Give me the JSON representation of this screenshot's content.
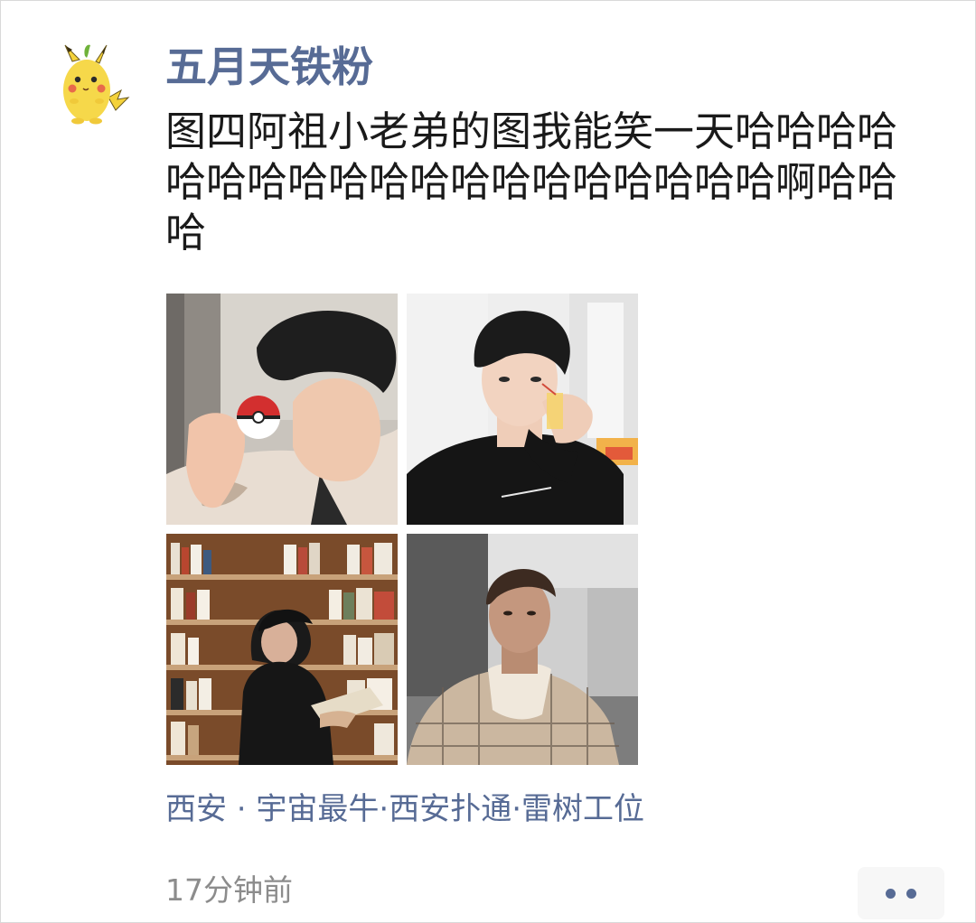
{
  "post": {
    "username": "五月天铁粉",
    "text": "图四阿祖小老弟的图我能笑一天哈哈哈哈哈哈哈哈哈哈哈哈哈哈哈哈哈哈哈啊哈哈哈",
    "location": "西安 · 宇宙最牛·西安扑通·雷树工位",
    "time": "17分钟前",
    "avatar_icon": "pikachu-icon",
    "more_icon": "more-dots-icon"
  },
  "photos": [
    {
      "name": "photo-1",
      "icon": "photo-icon"
    },
    {
      "name": "photo-2",
      "icon": "photo-icon"
    },
    {
      "name": "photo-3",
      "icon": "photo-icon"
    },
    {
      "name": "photo-4",
      "icon": "photo-icon"
    }
  ],
  "colors": {
    "link": "#576b95",
    "text": "#1a1a1a",
    "muted": "#8c8c8c"
  }
}
